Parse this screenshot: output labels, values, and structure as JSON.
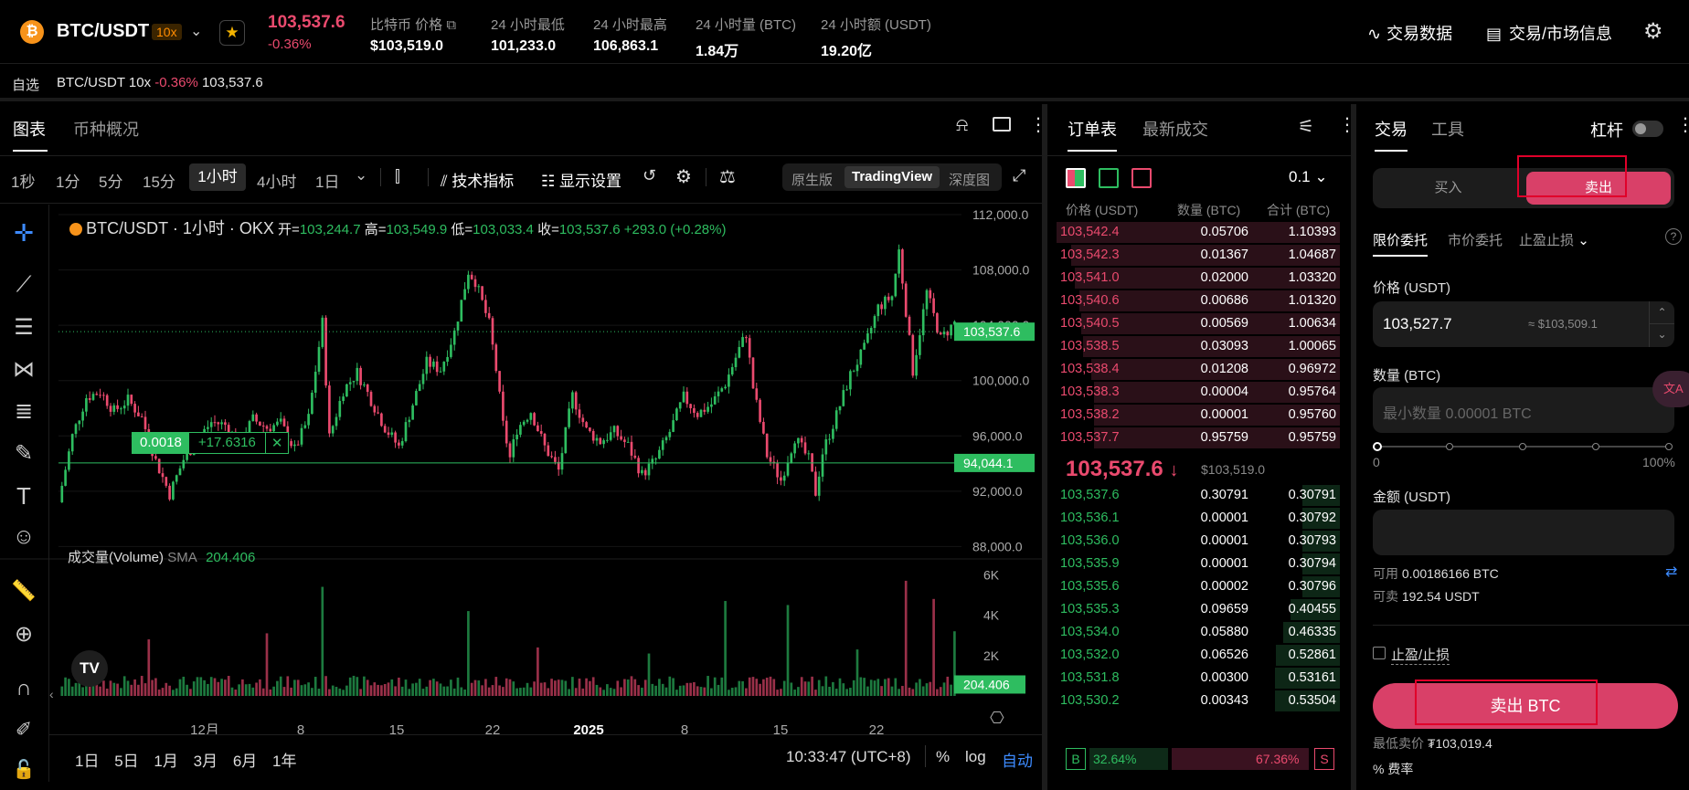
{
  "header": {
    "pair": "BTC/USDT",
    "leverage": "10x",
    "last_price": "103,537.6",
    "change": "-0.36%",
    "stats": [
      {
        "label": "比特币 价格",
        "value": "$103,519.0"
      },
      {
        "label": "24 小时最低",
        "value": "101,233.0"
      },
      {
        "label": "24 小时最高",
        "value": "106,863.1"
      },
      {
        "label": "24 小时量 (BTC)",
        "value": "1.84万"
      },
      {
        "label": "24 小时额 (USDT)",
        "value": "19.20亿"
      }
    ],
    "links": {
      "trade_data": "交易数据",
      "market_info": "交易/市场信息"
    }
  },
  "favorites": {
    "label": "自选",
    "pair": "BTC/USDT 10x",
    "change": "-0.36%",
    "price": "103,537.6"
  },
  "chart_tabs": [
    "图表",
    "币种概况"
  ],
  "toolbar": {
    "intervals": [
      "1秒",
      "1分",
      "5分",
      "15分",
      "1小时",
      "4小时",
      "1日"
    ],
    "active_interval": "1小时",
    "indicators": "技术指标",
    "display": "显示设置",
    "views": [
      "原生版",
      "TradingView",
      "深度图"
    ],
    "active_view": "TradingView"
  },
  "legend": {
    "title": "BTC/USDT · 1小时 · OKX",
    "o_lbl": "开=",
    "o": "103,244.7",
    "h_lbl": "高=",
    "h": "103,549.9",
    "l_lbl": "低=",
    "l": "103,033.4",
    "c_lbl": "收=",
    "c": "103,537.6",
    "chg": "+293.0 (+0.28%)"
  },
  "position": {
    "qty": "0.0018",
    "pnl": "+17.6316",
    "close": "✕"
  },
  "volume_legend": {
    "label": "成交量(Volume)",
    "sma": "SMA",
    "value": "204.406"
  },
  "bottom": {
    "ranges": [
      "1日",
      "5日",
      "1月",
      "3月",
      "6月",
      "1年"
    ],
    "time": "10:33:47 (UTC+8)",
    "pct": "%",
    "log": "log",
    "auto": "自动"
  },
  "chart_data": {
    "type": "candlestick",
    "title": "BTC/USDT · 1小时 · OKX",
    "price_ticks": [
      "112,000.0",
      "108,000.0",
      "104,000.0",
      "100,000.0",
      "96,000.0",
      "92,000.0",
      "88,000.0"
    ],
    "ylim": [
      87500,
      112200
    ],
    "last_price_label": "103,537.6",
    "last_price": 103537.6,
    "entry_label": "94,044.1",
    "entry_price": 94044.1,
    "volume_ticks": [
      "6K",
      "4K",
      "2K"
    ],
    "volume_max": 6600,
    "volume_last_label": "204.406",
    "volume_last": 204.406,
    "x_labels": [
      "12月",
      "8",
      "15",
      "22",
      "2025",
      "8",
      "15",
      "22"
    ],
    "path": [
      [
        0,
        91200
      ],
      [
        4,
        96000
      ],
      [
        8,
        98800
      ],
      [
        12,
        99200
      ],
      [
        16,
        97800
      ],
      [
        20,
        98600
      ],
      [
        24,
        97300
      ],
      [
        28,
        94200
      ],
      [
        32,
        91800
      ],
      [
        36,
        94300
      ],
      [
        40,
        95700
      ],
      [
        44,
        97000
      ],
      [
        48,
        96800
      ],
      [
        52,
        95500
      ],
      [
        56,
        97200
      ],
      [
        60,
        96600
      ],
      [
        64,
        96900
      ],
      [
        68,
        95000
      ],
      [
        72,
        97300
      ],
      [
        76,
        104200
      ],
      [
        78,
        95900
      ],
      [
        82,
        99300
      ],
      [
        86,
        100600
      ],
      [
        90,
        98600
      ],
      [
        94,
        96600
      ],
      [
        98,
        95200
      ],
      [
        102,
        98300
      ],
      [
        106,
        101300
      ],
      [
        110,
        100800
      ],
      [
        114,
        103500
      ],
      [
        118,
        107900
      ],
      [
        120,
        107200
      ],
      [
        124,
        104100
      ],
      [
        126,
        100800
      ],
      [
        128,
        96800
      ],
      [
        130,
        94400
      ],
      [
        132,
        96500
      ],
      [
        136,
        97800
      ],
      [
        140,
        95200
      ],
      [
        144,
        93500
      ],
      [
        148,
        98900
      ],
      [
        152,
        96400
      ],
      [
        156,
        95600
      ],
      [
        160,
        96300
      ],
      [
        164,
        95300
      ],
      [
        168,
        93200
      ],
      [
        172,
        94300
      ],
      [
        176,
        96300
      ],
      [
        180,
        98800
      ],
      [
        184,
        97600
      ],
      [
        188,
        98300
      ],
      [
        192,
        99800
      ],
      [
        196,
        102300
      ],
      [
        198,
        103400
      ],
      [
        200,
        99500
      ],
      [
        204,
        94600
      ],
      [
        208,
        92800
      ],
      [
        212,
        95900
      ],
      [
        216,
        94300
      ],
      [
        218,
        91900
      ],
      [
        220,
        94800
      ],
      [
        224,
        97500
      ],
      [
        228,
        100400
      ],
      [
        232,
        102300
      ],
      [
        236,
        105300
      ],
      [
        240,
        106100
      ],
      [
        242,
        109400
      ],
      [
        246,
        100700
      ],
      [
        250,
        106400
      ],
      [
        254,
        103000
      ],
      [
        258,
        104200
      ]
    ],
    "volume_spikes": [
      [
        76,
        5400
      ],
      [
        118,
        4200
      ],
      [
        192,
        4700
      ],
      [
        210,
        4500
      ],
      [
        244,
        5700
      ],
      [
        252,
        4800
      ],
      [
        258,
        3200
      ],
      [
        26,
        2800
      ],
      [
        60,
        3100
      ],
      [
        138,
        2400
      ],
      [
        170,
        2100
      ],
      [
        230,
        2300
      ]
    ]
  },
  "orderbook": {
    "tabs": [
      "订单表",
      "最新成交"
    ],
    "precision": "0.1",
    "headers": [
      "价格 (USDT)",
      "数量 (BTC)",
      "合计 (BTC)"
    ],
    "asks": [
      [
        "103,542.4",
        "0.05706",
        "1.10393"
      ],
      [
        "103,542.3",
        "0.01367",
        "1.04687"
      ],
      [
        "103,541.0",
        "0.02000",
        "1.03320"
      ],
      [
        "103,540.6",
        "0.00686",
        "1.01320"
      ],
      [
        "103,540.5",
        "0.00569",
        "1.00634"
      ],
      [
        "103,538.5",
        "0.03093",
        "1.00065"
      ],
      [
        "103,538.4",
        "0.01208",
        "0.96972"
      ],
      [
        "103,538.3",
        "0.00004",
        "0.95764"
      ],
      [
        "103,538.2",
        "0.00001",
        "0.95760"
      ],
      [
        "103,537.7",
        "0.95759",
        "0.95759"
      ]
    ],
    "mid": "103,537.6",
    "mid_arrow": "↓",
    "mid_usd": "$103,519.0",
    "bids": [
      [
        "103,537.6",
        "0.30791",
        "0.30791"
      ],
      [
        "103,536.1",
        "0.00001",
        "0.30792"
      ],
      [
        "103,536.0",
        "0.00001",
        "0.30793"
      ],
      [
        "103,535.9",
        "0.00001",
        "0.30794"
      ],
      [
        "103,535.6",
        "0.00002",
        "0.30796"
      ],
      [
        "103,535.3",
        "0.09659",
        "0.40455"
      ],
      [
        "103,534.0",
        "0.05880",
        "0.46335"
      ],
      [
        "103,532.0",
        "0.06526",
        "0.52861"
      ],
      [
        "103,531.8",
        "0.00300",
        "0.53161"
      ],
      [
        "103,530.2",
        "0.00343",
        "0.53504"
      ]
    ],
    "buy_pct": "32.64%",
    "sell_pct": "67.36%",
    "b": "B",
    "s": "S"
  },
  "trade": {
    "tabs": [
      "交易",
      "工具"
    ],
    "leverage": "杠杆",
    "buy": "买入",
    "sell": "卖出",
    "order_types": [
      "限价委托",
      "市价委托",
      "止盈止损"
    ],
    "price_label": "价格 (USDT)",
    "price": "103,527.7",
    "price_usd": "≈ $103,509.1",
    "qty_label": "数量 (BTC)",
    "qty_placeholder": "最小数量 0.00001 BTC",
    "slider_min": "0",
    "slider_max": "100%",
    "amount_label": "金额 (USDT)",
    "avail_label": "可用",
    "avail": "0.00186166 BTC",
    "sellable_label": "可卖",
    "sellable": "192.54 USDT",
    "tpsl": "止盈/止损",
    "submit": "卖出 BTC",
    "min_label": "最低卖价",
    "min": "₮103,019.4",
    "fee": "费率",
    "side_glyph": "文A"
  },
  "colors": {
    "up": "#2ebd60",
    "down": "#ea4a6e",
    "accent": "#ff8c00"
  }
}
